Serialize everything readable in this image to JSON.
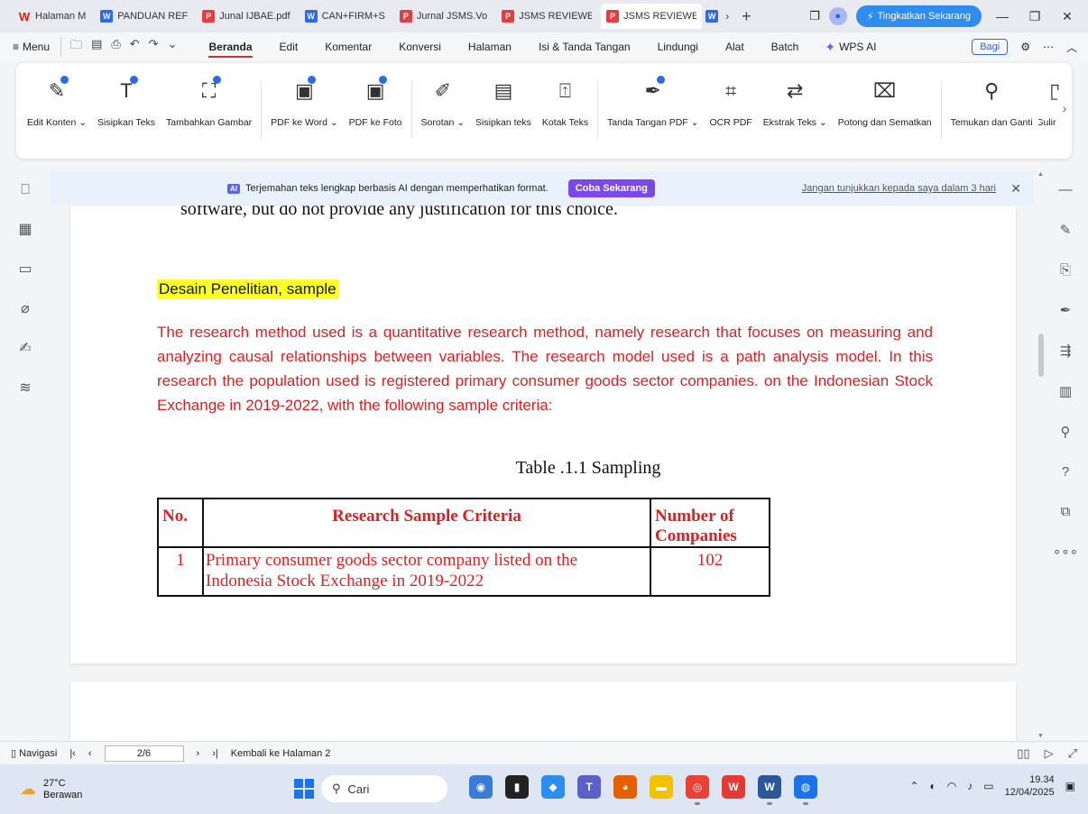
{
  "tabs": [
    {
      "label": "Halaman M",
      "icon": "wps",
      "active": false
    },
    {
      "label": "PANDUAN REF",
      "icon": "w",
      "active": false
    },
    {
      "label": "Junal IJBAE.pdf",
      "icon": "p",
      "active": false
    },
    {
      "label": "CAN+FIRM+S",
      "icon": "w",
      "active": false
    },
    {
      "label": "Jurnal JSMS.Vo",
      "icon": "p",
      "active": false
    },
    {
      "label": "JSMS REVIEWE",
      "icon": "p",
      "active": false
    },
    {
      "label": "JSMS REVIEWE",
      "icon": "p",
      "active": true
    }
  ],
  "tabbar": {
    "more": "W",
    "upgrade_label": "Tingkatkan Sekarang"
  },
  "menubar": {
    "menu_label": "Menu",
    "tabs": [
      "Beranda",
      "Edit",
      "Komentar",
      "Konversi",
      "Halaman",
      "Isi & Tanda Tangan",
      "Lindungi",
      "Alat",
      "Batch"
    ],
    "active_tab": "Beranda",
    "wps_ai": "WPS AI",
    "share": "Bagi"
  },
  "ribbon": [
    {
      "label": "Edit Konten ⌄",
      "icon": "edit-content-icon",
      "glyph": "✎"
    },
    {
      "label": "Sisipkan Teks",
      "icon": "insert-text-icon",
      "glyph": "T"
    },
    {
      "label": "Tambahkan Gambar",
      "icon": "add-image-icon",
      "glyph": "⛶"
    },
    {
      "label": "PDF ke Word ⌄",
      "icon": "pdf-to-word-icon",
      "glyph": "W"
    },
    {
      "label": "PDF ke Foto",
      "icon": "pdf-to-photo-icon",
      "glyph": "▣"
    },
    {
      "label": "Sorotan ⌄",
      "icon": "highlight-icon",
      "glyph": "✐"
    },
    {
      "label": "Sisipkan teks",
      "icon": "insert-textbox-icon",
      "glyph": "▤"
    },
    {
      "label": "Kotak Teks",
      "icon": "text-box-icon",
      "glyph": "A"
    },
    {
      "label": "Tanda Tangan PDF ⌄",
      "icon": "signature-icon",
      "glyph": "✒"
    },
    {
      "label": "OCR PDF",
      "icon": "ocr-icon",
      "glyph": "⌗"
    },
    {
      "label": "Ekstrak Teks ⌄",
      "icon": "extract-text-icon",
      "glyph": "⇄"
    },
    {
      "label": "Potong dan Sematkan",
      "icon": "crop-pin-icon",
      "glyph": "⌧"
    },
    {
      "label": "Temukan dan Ganti",
      "icon": "find-replace-icon",
      "glyph": "⚲"
    },
    {
      "label": "Gulir Oto",
      "icon": "auto-scroll-icon",
      "glyph": "▯"
    }
  ],
  "notification": {
    "badge": "AI",
    "text": "Terjemahan teks lengkap berbasis AI dengan memperhatikan format.",
    "cta": "Coba Sekarang",
    "dismiss": "Jangan tunjukkan kepada saya dalam 3 hari"
  },
  "document": {
    "cut_line": "software, but do not provide any justification for this choice.",
    "heading": "Desain Penelitian, sample",
    "paragraph": "The research method used is a quantitative research method, namely research that focuses on measuring and analyzing causal relationships between variables. The research model used is a path analysis model. In this research the population used is registered primary consumer goods sector companies. on the Indonesian Stock Exchange in 2019-2022, with the following sample criteria:",
    "table_caption": "Table .1.1 Sampling",
    "table": {
      "headers": [
        "No.",
        "Research Sample Criteria",
        "Number of Companies"
      ],
      "rows": [
        [
          "1",
          "Primary consumer goods sector company listed on the Indonesia Stock Exchange in 2019-2022",
          "102"
        ]
      ]
    }
  },
  "statusbar": {
    "nav_label": "Navigasi",
    "page": "2/6",
    "back_label": "Kembali ke Halaman 2"
  },
  "taskbar": {
    "temp": "27°C",
    "weather": "Berawan",
    "search_placeholder": "Cari",
    "time": "19.34",
    "date": "12/04/2025"
  },
  "colors": {
    "doc_text_red": "#e02020",
    "highlight_yellow": "#ffff2a",
    "accent_blue": "#2f8cf0",
    "cta_purple": "#7b48ea"
  }
}
